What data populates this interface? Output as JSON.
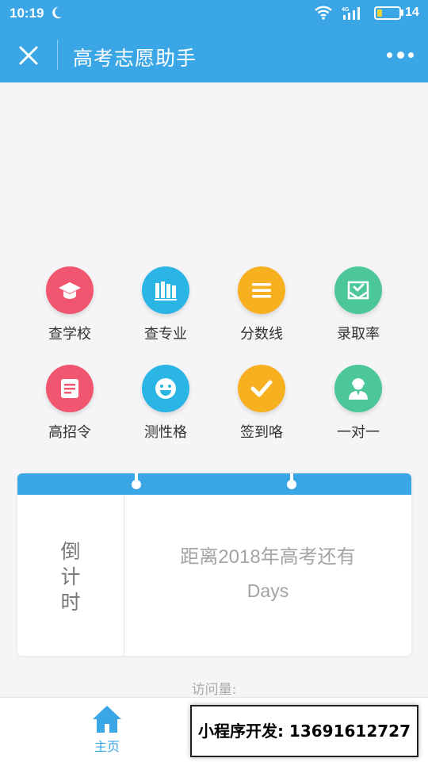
{
  "status": {
    "time": "10:19",
    "network": "4G",
    "battery": "14"
  },
  "nav": {
    "title": "高考志愿助手",
    "close_icon": "close-icon",
    "more_icon": "more-icon"
  },
  "menu": [
    {
      "label": "查学校",
      "icon": "graduation-cap-icon",
      "color": "#f0566f"
    },
    {
      "label": "查专业",
      "icon": "books-icon",
      "color": "#2ab5e5"
    },
    {
      "label": "分数线",
      "icon": "list-icon",
      "color": "#f6b020"
    },
    {
      "label": "录取率",
      "icon": "envelope-check-icon",
      "color": "#4cc79a"
    },
    {
      "label": "高招令",
      "icon": "document-icon",
      "color": "#f0566f"
    },
    {
      "label": "测性格",
      "icon": "smile-icon",
      "color": "#2ab5e5"
    },
    {
      "label": "签到咯",
      "icon": "check-icon",
      "color": "#f6b020"
    },
    {
      "label": "一对一",
      "icon": "consultant-icon",
      "color": "#4cc79a"
    }
  ],
  "countdown": {
    "label_lines": [
      "倒",
      "计",
      "时"
    ],
    "title": "距离2018年高考还有",
    "days": "Days"
  },
  "visits": {
    "label": "访问量:"
  },
  "tabbar": {
    "home_label": "主页",
    "active_color": "#3aa6e6"
  },
  "promo": {
    "text": "小程序开发: 13691612727"
  }
}
